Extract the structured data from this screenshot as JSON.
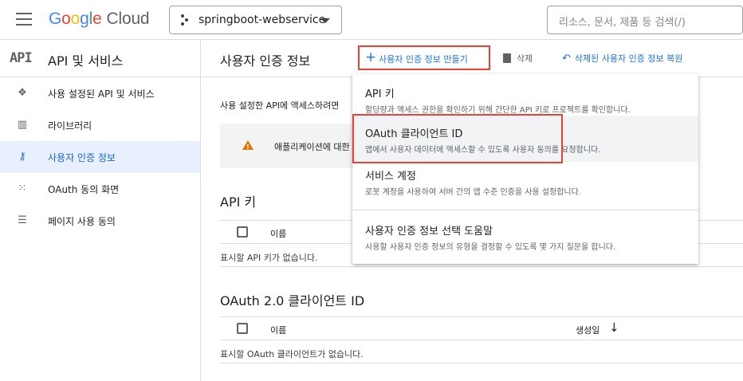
{
  "header": {
    "logo_google": [
      "G",
      "o",
      "o",
      "g",
      "l",
      "e"
    ],
    "logo_cloud": "Cloud",
    "project_name": "springboot-webservice",
    "search_placeholder": "리소스, 문서, 제품 등 검색(/)"
  },
  "sidebar": {
    "logo_text": "API",
    "title": "API 및 서비스",
    "items": [
      {
        "label": "사용 설정된 API 및 서비스",
        "icon": "diamond-dots-icon",
        "active": false
      },
      {
        "label": "라이브러리",
        "icon": "library-icon",
        "active": false
      },
      {
        "label": "사용자 인증 정보",
        "icon": "key-icon",
        "active": true
      },
      {
        "label": "OAuth 동의 화면",
        "icon": "dots-grid-icon",
        "active": false
      },
      {
        "label": "페이지 사용 동의",
        "icon": "settings-list-icon",
        "active": false
      }
    ]
  },
  "main": {
    "page_title": "사용자 인증 정보",
    "create_button": "사용자 인증 정보 만들기",
    "delete_button": "삭제",
    "restore_button": "삭제된 사용자 인증 정보 복원",
    "intro_text": "사용 설정한 API에 액세스하려면",
    "banner_text": "애플리케이션에 대한",
    "api_keys": {
      "title": "API 키",
      "col_name": "이름",
      "empty": "표시할 API 키가 없습니다."
    },
    "oauth": {
      "title": "OAuth 2.0 클라이언트 ID",
      "col_name": "이름",
      "col_created": "생성일",
      "empty": "표시할 OAuth 클라이언트가 없습니다."
    }
  },
  "menu": {
    "items": [
      {
        "title": "API 키",
        "desc": "할당량과 액세스 권한을 확인하기 위해 간단한 API 키로 프로젝트를 확인합니다."
      },
      {
        "title": "OAuth 클라이언트 ID",
        "desc": "앱에서 사용자 데이터에 액세스할 수 있도록 사용자 동의를 요청합니다."
      },
      {
        "title": "서비스 계정",
        "desc": "로봇 계정을 사용하여 서버 간의 앱 수준 인증을 사용 설정합니다."
      },
      {
        "title": "사용자 인증 정보 선택 도움말",
        "desc": "사용할 사용자 인증 정보의 유형을 결정할 수 있도록 몇 가지 질문을 합니다."
      }
    ]
  },
  "colors": {
    "accent": "#1a73e8",
    "highlight_border": "#ea4335",
    "active_bg": "#e8f0fe",
    "warning": "#e37400"
  }
}
